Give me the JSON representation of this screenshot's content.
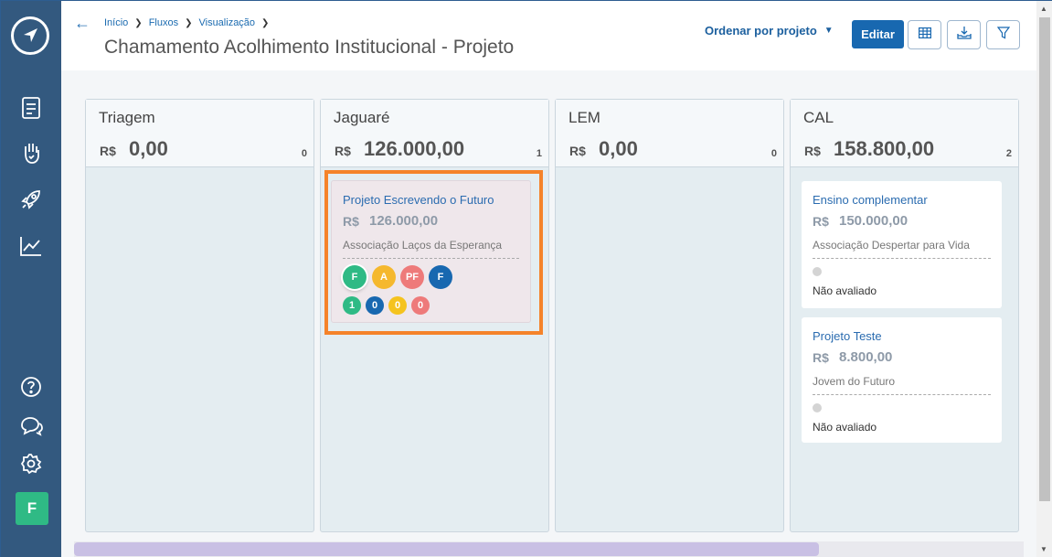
{
  "sidebar": {
    "logo": "paper-plane-icon",
    "items": [
      {
        "name": "document-icon"
      },
      {
        "name": "hand-heart-icon"
      },
      {
        "name": "rocket-icon"
      },
      {
        "name": "chart-line-icon"
      }
    ],
    "bottom": [
      {
        "name": "help-icon"
      },
      {
        "name": "chat-icon"
      },
      {
        "name": "gear-icon"
      }
    ],
    "avatar": "F"
  },
  "header": {
    "breadcrumbs": [
      "Início",
      "Fluxos",
      "Visualização"
    ],
    "title": "Chamamento Acolhimento Institucional - Projeto",
    "sort_label": "Ordenar por projeto",
    "edit_label": "Editar"
  },
  "currency": "R$",
  "columns": [
    {
      "name": "Triagem",
      "total": "0,00",
      "count": "0"
    },
    {
      "name": "Jaguaré",
      "total": "126.000,00",
      "count": "1"
    },
    {
      "name": "LEM",
      "total": "0,00",
      "count": "0"
    },
    {
      "name": "CAL",
      "total": "158.800,00",
      "count": "2"
    }
  ],
  "cards": {
    "jaguare": {
      "title": "Projeto Escrevendo o Futuro",
      "value": "126.000,00",
      "org": "Associação Laços da Esperança",
      "avatars": [
        {
          "label": "F",
          "color": "#2fba85"
        },
        {
          "label": "A",
          "color": "#f5b82e"
        },
        {
          "label": "PF",
          "color": "#ee7a7a"
        },
        {
          "label": "F",
          "color": "#1868b0"
        }
      ],
      "badges": [
        {
          "label": "1",
          "color": "#2fba85"
        },
        {
          "label": "0",
          "color": "#1868b0"
        },
        {
          "label": "0",
          "color": "#f5c31e"
        },
        {
          "label": "0",
          "color": "#ee7a7a"
        }
      ]
    },
    "cal": [
      {
        "title": "Ensino complementar",
        "value": "150.000,00",
        "org": "Associação Despertar para Vida",
        "status": "Não avaliado"
      },
      {
        "title": "Projeto Teste",
        "value": "8.800,00",
        "org": "Jovem do Futuro",
        "status": "Não avaliado"
      }
    ]
  },
  "colors": {
    "sidebar": "#33597f",
    "accent": "#1868b0",
    "highlight": "#f5832a"
  }
}
